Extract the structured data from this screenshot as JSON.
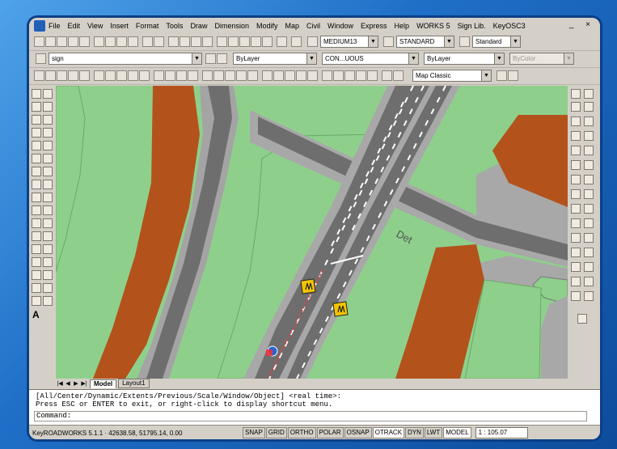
{
  "window": {
    "menu": [
      "File",
      "Edit",
      "View",
      "Insert",
      "Format",
      "Tools",
      "Draw",
      "Dimension",
      "Modify",
      "Map",
      "Civil",
      "Window",
      "Express",
      "Help",
      "WORKS 5",
      "Sign Lib.",
      "KeyOSC3"
    ],
    "controls": "_ ×"
  },
  "toolbar1": {
    "style_combo": "MEDIUM13",
    "dimstyle_combo": "STANDARD",
    "table_combo": "Standard"
  },
  "toolbar2": {
    "layer_combo": "sign",
    "color_combo": "ByLayer",
    "linetype_combo": "CON...UOUS",
    "lineweight_combo": "ByLayer",
    "plotstyle_combo": "ByColor"
  },
  "toolbar3": {
    "workspace_combo": "Map Classic"
  },
  "map": {
    "road_label": "Det",
    "colors": {
      "grass": "#8ed08b",
      "soil": "#b4521c",
      "road": "#6e6e6e",
      "verge": "#a8a8a8",
      "sign": "#f2c400"
    }
  },
  "left_tool_letter": "A",
  "tabs": {
    "model": "Model",
    "layout1": "Layout1"
  },
  "command": {
    "line1": "[All/Center/Dynamic/Extents/Previous/Scale/Window/Object] <real time>:",
    "line2": "Press ESC or ENTER to exit, or right-click to display shortcut menu.",
    "prompt": "Command:"
  },
  "status": {
    "coords": "KeyROADWORKS 5.1.1  ·  42638.58, 51795.14, 0.00",
    "toggles": [
      "SNAP",
      "GRID",
      "ORTHO",
      "POLAR",
      "OSNAP",
      "OTRACK",
      "DYN",
      "LWT",
      "MODEL"
    ],
    "scale": "1 : 105.07"
  }
}
